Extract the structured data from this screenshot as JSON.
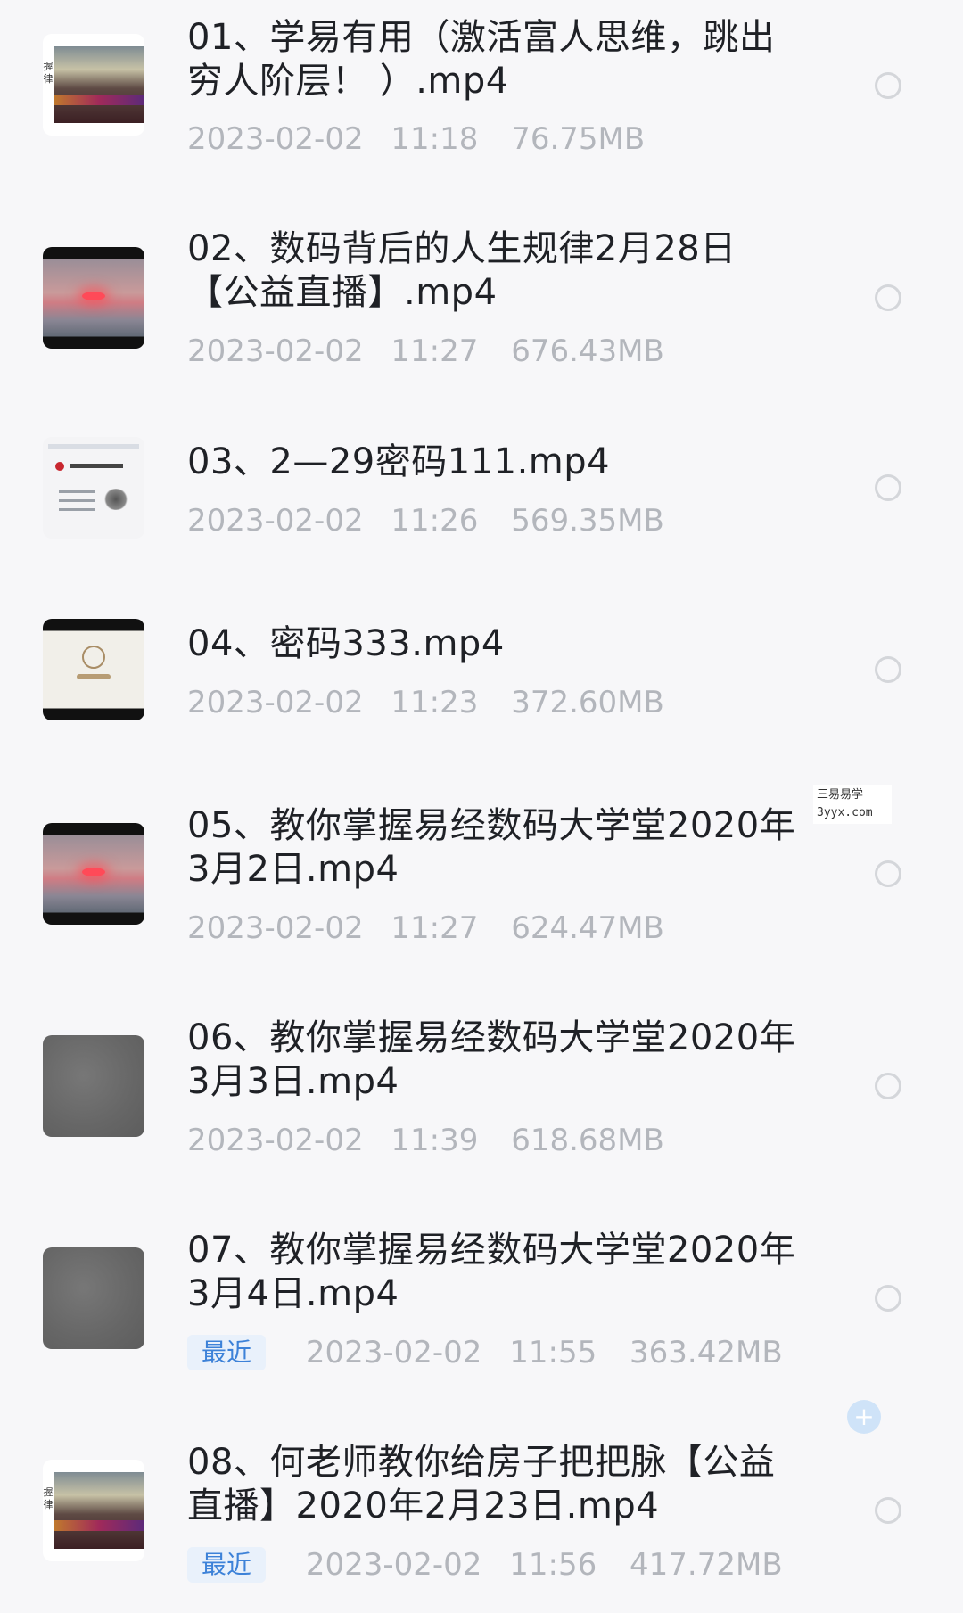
{
  "files": [
    {
      "title": "01、学易有用（激活富人思维，跳出\n穷人阶层！ ）.mp4",
      "date": "2023-02-02",
      "time": "11:18",
      "size": "76.75MB",
      "thumb": "stage"
    },
    {
      "title": "02、数码背后的人生规律2月28日\n【公益直播】.mp4",
      "date": "2023-02-02",
      "time": "11:27",
      "size": "676.43MB",
      "thumb": "sunset"
    },
    {
      "title": "03、2—29密码111.mp4",
      "date": "2023-02-02",
      "time": "11:26",
      "size": "569.35MB",
      "thumb": "slide"
    },
    {
      "title": "04、密码333.mp4",
      "date": "2023-02-02",
      "time": "11:23",
      "size": "372.60MB",
      "thumb": "logo"
    },
    {
      "title": "05、教你掌握易经数码大学堂2020年\n3月2日.mp4",
      "date": "2023-02-02",
      "time": "11:27",
      "size": "624.47MB",
      "thumb": "sunset"
    },
    {
      "title": "06、教你掌握易经数码大学堂2020年\n3月3日.mp4",
      "date": "2023-02-02",
      "time": "11:39",
      "size": "618.68MB",
      "thumb": "gray"
    },
    {
      "title": "07、教你掌握易经数码大学堂2020年\n3月4日.mp4",
      "date": "2023-02-02",
      "time": "11:55",
      "size": "363.42MB",
      "thumb": "gray",
      "tag": "最近"
    },
    {
      "title": "08、何老师教你给房子把把脉【公益\n直播】2020年2月23日.mp4",
      "date": "2023-02-02",
      "time": "11:56",
      "size": "417.72MB",
      "thumb": "stage",
      "tag": "最近"
    }
  ],
  "watermark": {
    "line1": "三易易学",
    "line2": "3yyx.com"
  },
  "stage_thumb_side_text": "握\n律",
  "colors": {
    "accent": "#3d82d8",
    "meta_text": "#b3b6bc",
    "title_text": "#1f2126"
  }
}
